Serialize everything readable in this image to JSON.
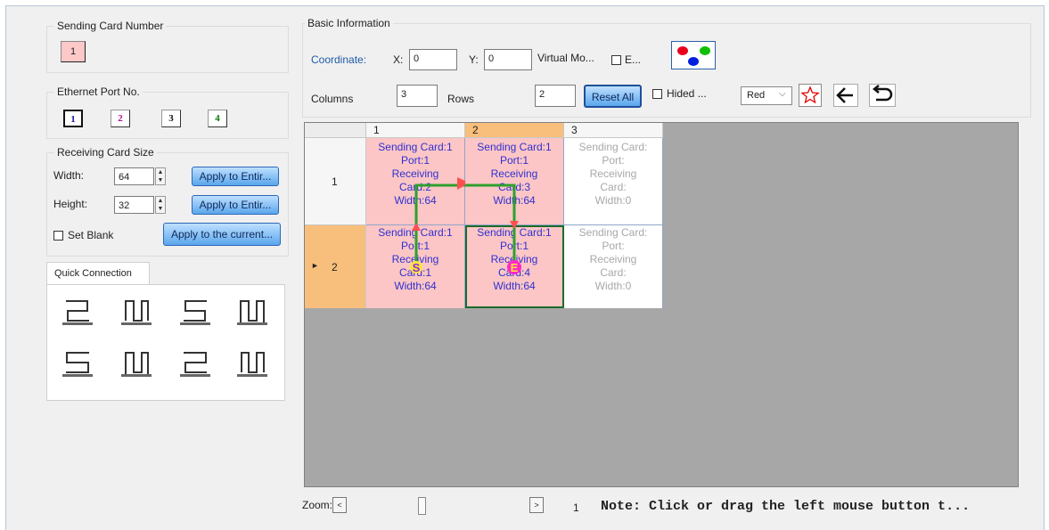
{
  "sending_card": {
    "title": "Sending Card Number",
    "value": "1"
  },
  "ethernet": {
    "title": "Ethernet Port No.",
    "ports": [
      "1",
      "2",
      "3",
      "4"
    ]
  },
  "receiving_size": {
    "title": "Receiving Card Size",
    "width_label": "Width:",
    "width_value": "64",
    "height_label": "Height:",
    "height_value": "32",
    "apply_entire_label": "Apply to Entir...",
    "set_blank_label": "Set Blank",
    "apply_current_label": "Apply to the current..."
  },
  "quick_connection": {
    "tab_label": "Quick Connection"
  },
  "basic": {
    "title": "Basic Information",
    "coordinate_label": "Coordinate:",
    "x_label": "X:",
    "x_value": "0",
    "y_label": "Y:",
    "y_value": "0",
    "virtual_label": "Virtual Mo...",
    "e_label": "E...",
    "columns_label": "Columns",
    "columns_value": "3",
    "rows_label": "Rows",
    "rows_value": "2",
    "reset_all_label": "Reset All",
    "hided_label": "Hided ...",
    "color_select": "Red",
    "colors": {
      "red": "#e8001c",
      "green": "#10c000",
      "blue": "#0020e0"
    }
  },
  "grid": {
    "col_headers": [
      "1",
      "2",
      "3"
    ],
    "row_headers": [
      "1",
      "2"
    ],
    "cells": [
      [
        {
          "lines": [
            "Sending Card:1",
            "Port:1",
            "Receiving",
            "Card:2",
            "Width:64"
          ],
          "active": true
        },
        {
          "lines": [
            "Sending Card:1",
            "Port:1",
            "Receiving",
            "Card:3",
            "Width:64"
          ],
          "active": true
        },
        {
          "lines": [
            "Sending Card:",
            "Port:",
            "Receiving",
            "Card:",
            "Width:0"
          ],
          "active": false
        }
      ],
      [
        {
          "lines": [
            "Sending Card:1",
            "Port:1",
            "Receiving",
            "Card:1",
            "Width:64"
          ],
          "active": true,
          "marker": "S"
        },
        {
          "lines": [
            "Sending Card:1",
            "Port:1",
            "Receiving",
            "Card:4",
            "Width:64"
          ],
          "active": true,
          "marker": "E"
        },
        {
          "lines": [
            "Sending Card:",
            "Port:",
            "Receiving",
            "Card:",
            "Width:0"
          ],
          "active": false
        }
      ]
    ]
  },
  "zoom": {
    "label": "Zoom:",
    "left_btn": "<",
    "right_btn": ">",
    "value": "1"
  },
  "note": "Note: Click or drag the left mouse button t..."
}
